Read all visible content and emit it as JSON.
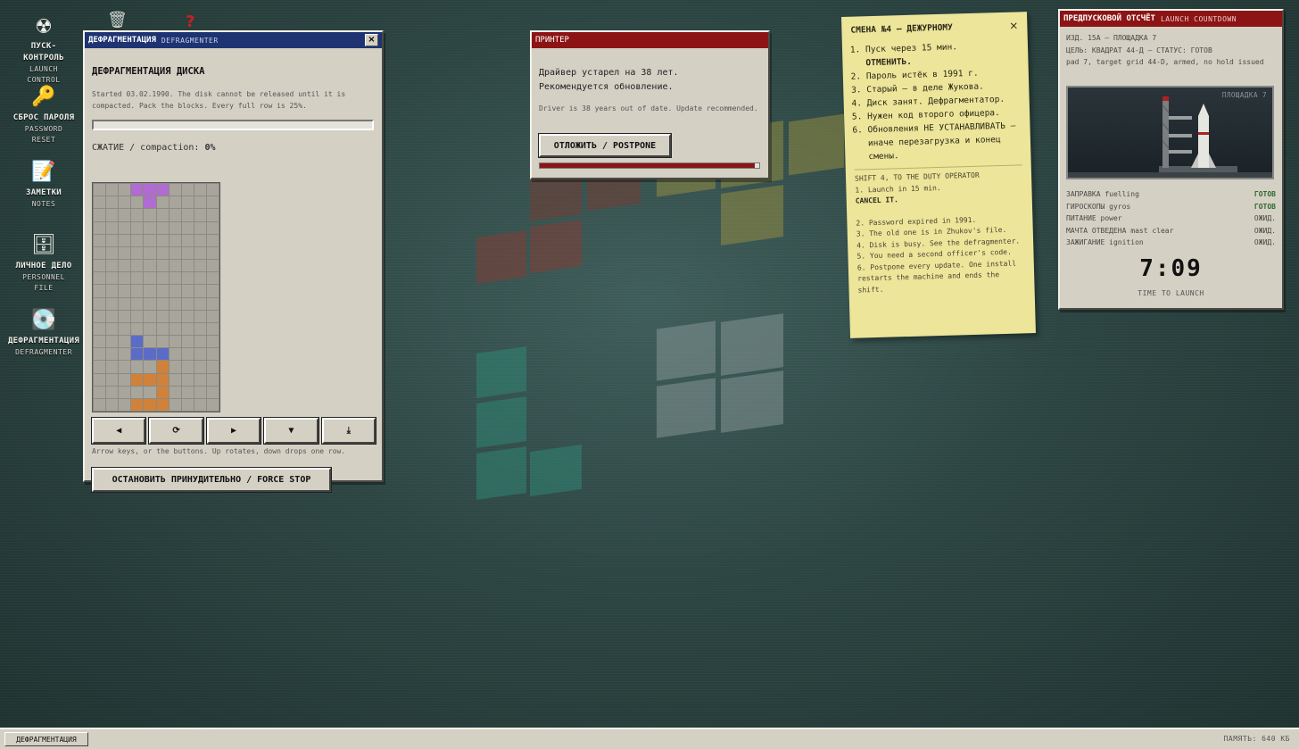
{
  "desktop_icons": [
    {
      "icon": "radiation-icon",
      "glyph": "☢",
      "ru": "ПУСК-КОНТРОЛЬ",
      "en": "LAUNCH CONTROL"
    },
    {
      "icon": "key-icon",
      "glyph": "🔑",
      "ru": "СБРОС ПАРОЛЯ",
      "en": "PASSWORD RESET"
    },
    {
      "icon": "notepad-icon",
      "glyph": "📝",
      "ru": "ЗАМЕТКИ",
      "en": "NOTES"
    },
    {
      "icon": "file-cabinet-icon",
      "glyph": "🗄",
      "ru": "ЛИЧНОЕ ДЕЛО",
      "en": "PERSONNEL FILE"
    },
    {
      "icon": "disc-icon",
      "glyph": "💽",
      "ru": "ДЕФРАГМЕНТАЦИЯ",
      "en": "DEFRAGMENTER"
    }
  ],
  "extra_icons": {
    "help_glyph": "?",
    "trash_glyph": "🗑"
  },
  "defrag": {
    "title": "ДЕФРАГМЕНТАЦИЯ",
    "title_sub": "DEFRAGMENTER",
    "heading": "ДЕФРАГМЕНТАЦИЯ ДИСКА",
    "info": "Started 03.02.1990. The disk cannot be released until it is compacted. Pack the blocks. Every full row is 25%.",
    "progress": 0.0,
    "compaction_label": "СЖАТИЕ / compaction:",
    "compaction_value": "0%",
    "grid": {
      "cols": 10,
      "rows": 18,
      "filled": [
        {
          "r": 0,
          "c": 3,
          "color": "purple"
        },
        {
          "r": 0,
          "c": 4,
          "color": "purple"
        },
        {
          "r": 0,
          "c": 5,
          "color": "purple"
        },
        {
          "r": 1,
          "c": 4,
          "color": "purple"
        },
        {
          "r": 12,
          "c": 3,
          "color": "blue"
        },
        {
          "r": 13,
          "c": 3,
          "color": "blue"
        },
        {
          "r": 13,
          "c": 4,
          "color": "blue"
        },
        {
          "r": 13,
          "c": 5,
          "color": "blue"
        },
        {
          "r": 14,
          "c": 5,
          "color": "orange"
        },
        {
          "r": 15,
          "c": 3,
          "color": "orange"
        },
        {
          "r": 15,
          "c": 4,
          "color": "orange"
        },
        {
          "r": 15,
          "c": 5,
          "color": "orange"
        },
        {
          "r": 16,
          "c": 5,
          "color": "orange"
        },
        {
          "r": 17,
          "c": 3,
          "color": "orange"
        },
        {
          "r": 17,
          "c": 4,
          "color": "orange"
        },
        {
          "r": 17,
          "c": 5,
          "color": "orange"
        }
      ]
    },
    "controls": {
      "left": "◀",
      "rotate": "⟳",
      "right": "▶",
      "down": "▼",
      "drop": "⤓"
    },
    "hint": "Arrow keys, or the buttons. Up rotates, down drops one row.",
    "force_stop_label": "ОСТАНОВИТЬ ПРИНУДИТЕЛЬНО / FORCE STOP"
  },
  "printer": {
    "title": "ПРИНТЕР",
    "message_line1": "Драйвер устарел на 38 лет.",
    "message_line2": "Рекомендуется обновление.",
    "message_en": "Driver is 38 years out of date. Update recommended.",
    "postpone_label": "ОТЛОЖИТЬ / POSTPONE",
    "progress": 0.98
  },
  "note": {
    "title": "СМЕНА №4 — ДЕЖУРНОМУ",
    "close_glyph": "×",
    "items_ru": [
      {
        "text": "Пуск через 15 мин.",
        "bold": "ОТМЕНИТЬ."
      },
      {
        "text": "Пароль истёк в 1991 г."
      },
      {
        "text": "Старый — в деле Жукова."
      },
      {
        "text": "Диск занят. Дефрагментатор."
      },
      {
        "text": "Нужен код второго офицера."
      },
      {
        "text": "Обновления НЕ УСТАНАВЛИВАТЬ — иначе перезагрузка и конец смены."
      }
    ],
    "en_heading": "SHIFT 4, TO THE DUTY OPERATOR",
    "en_item1": "1. Launch in 15 min.",
    "en_item1_bold": "CANCEL IT.",
    "en_items": [
      "2. Password expired in 1991.",
      "3. The old one is in Zhukov's file.",
      "4. Disk is busy. See the defragmenter.",
      "5. You need a second officer's code.",
      "6. Postpone every update. One install restarts the machine and ends the shift."
    ]
  },
  "launch": {
    "title": "ПРЕДПУСКОВОЙ ОТСЧЁТ",
    "title_sub": "LAUNCH COUNTDOWN",
    "line1": "ИЗД. 15А — ПЛОЩАДКА 7",
    "line2": "ЦЕЛЬ: КВАДРАТ 44-Д — СТАТУС: ГОТОВ",
    "line3": "pad 7, target grid 44-D, armed, no hold issued",
    "image_label": "ПЛОЩАДКА 7",
    "statuses": [
      {
        "label": "ЗАПРАВКА fuelling",
        "value": "ГОТОВ",
        "ok": true
      },
      {
        "label": "ГИРОСКОПЫ gyros",
        "value": "ГОТОВ",
        "ok": true
      },
      {
        "label": "ПИТАНИЕ power",
        "value": "ОЖИД.",
        "ok": false
      },
      {
        "label": "МАЧТА ОТВЕДЕНА mast clear",
        "value": "ОЖИД.",
        "ok": false
      },
      {
        "label": "ЗАЖИГАНИЕ ignition",
        "value": "ОЖИД.",
        "ok": false
      }
    ],
    "countdown": "7:09",
    "countdown_label": "TIME TO LAUNCH"
  },
  "taskbar": {
    "task_label": "ДЕФРАГМЕНТАЦИЯ",
    "memory": "ПАМЯТЬ: 640 КБ"
  },
  "colors": {
    "defrag_titlebar": "#1e3472",
    "alert_titlebar": "#8c1414",
    "purple": "#b06cd0",
    "blue": "#5a6cc8",
    "orange": "#d0823a"
  }
}
